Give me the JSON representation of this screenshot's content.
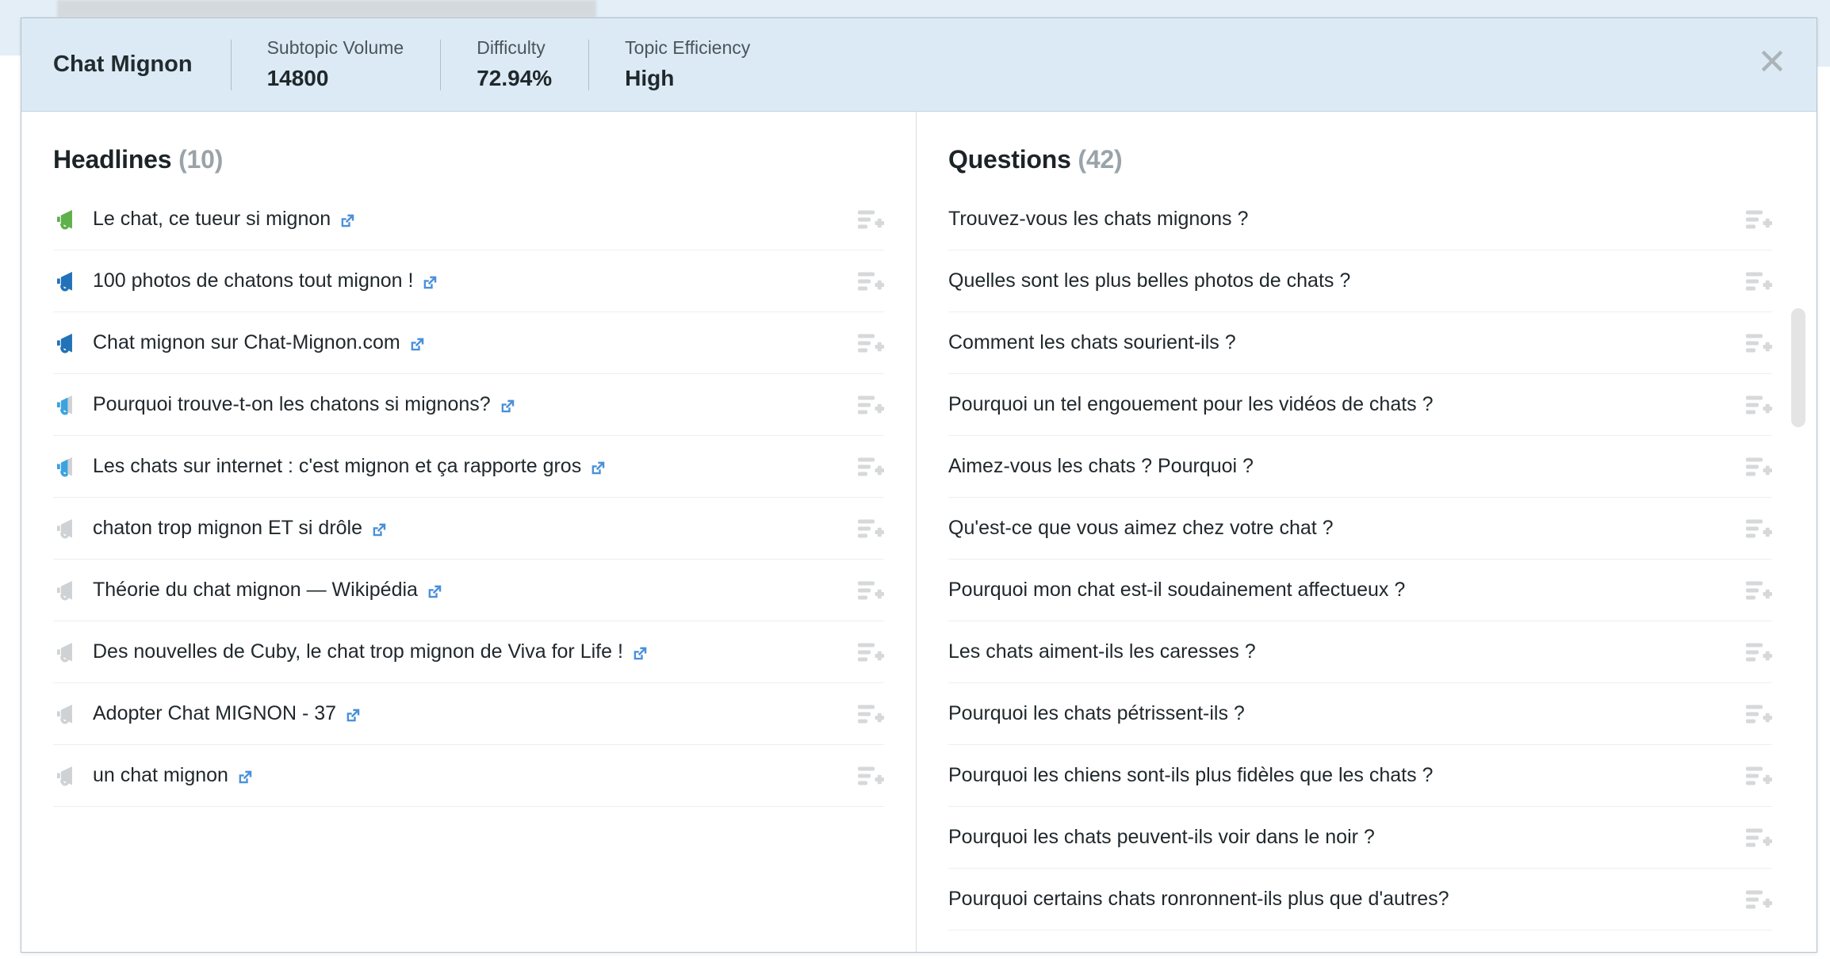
{
  "header": {
    "title": "Chat Mignon",
    "metrics": [
      {
        "label": "Subtopic Volume",
        "value": "14800"
      },
      {
        "label": "Difficulty",
        "value": "72.94%"
      },
      {
        "label": "Topic Efficiency",
        "value": "High"
      }
    ],
    "close_icon": "close-icon"
  },
  "colors": {
    "header_bg": "#dbeaf5",
    "megaphone_green": "#5eb14b",
    "megaphone_blue_dark": "#2272b9",
    "megaphone_blue_light": "#3ba3e0",
    "megaphone_grey": "#cfd2d4",
    "link_blue": "#4a90d9",
    "icon_grey": "#d6d8da"
  },
  "headlines": {
    "title": "Headlines",
    "count": "(10)",
    "items": [
      {
        "text": "Le chat, ce tueur si mignon",
        "icon": "megaphone-icon",
        "fill": 1.0,
        "color": "#5eb14b",
        "link_icon": "external-link-icon",
        "action_icon": "add-to-list-icon"
      },
      {
        "text": "100 photos de chatons tout mignon !",
        "icon": "megaphone-icon",
        "fill": 0.78,
        "color": "#2272b9",
        "link_icon": "external-link-icon",
        "action_icon": "add-to-list-icon"
      },
      {
        "text": "Chat mignon sur Chat-Mignon.com",
        "icon": "megaphone-icon",
        "fill": 0.78,
        "color": "#2272b9",
        "link_icon": "external-link-icon",
        "action_icon": "add-to-list-icon"
      },
      {
        "text": "Pourquoi trouve-t-on les chatons si mignons?",
        "icon": "megaphone-icon",
        "fill": 0.55,
        "color": "#3ba3e0",
        "link_icon": "external-link-icon",
        "action_icon": "add-to-list-icon"
      },
      {
        "text": "Les chats sur internet : c'est mignon et ça rapporte gros",
        "icon": "megaphone-icon",
        "fill": 0.55,
        "color": "#3ba3e0",
        "link_icon": "external-link-icon",
        "action_icon": "add-to-list-icon"
      },
      {
        "text": "chaton trop mignon ET si drôle",
        "icon": "megaphone-icon",
        "fill": 0.0,
        "color": "#cfd2d4",
        "link_icon": "external-link-icon",
        "action_icon": "add-to-list-icon"
      },
      {
        "text": "Théorie du chat mignon — Wikipédia",
        "icon": "megaphone-icon",
        "fill": 0.0,
        "color": "#cfd2d4",
        "link_icon": "external-link-icon",
        "action_icon": "add-to-list-icon"
      },
      {
        "text": "Des nouvelles de Cuby, le chat trop mignon de Viva for Life !",
        "icon": "megaphone-icon",
        "fill": 0.0,
        "color": "#cfd2d4",
        "link_icon": "external-link-icon",
        "action_icon": "add-to-list-icon"
      },
      {
        "text": "Adopter Chat MIGNON - 37",
        "icon": "megaphone-icon",
        "fill": 0.0,
        "color": "#cfd2d4",
        "link_icon": "external-link-icon",
        "action_icon": "add-to-list-icon"
      },
      {
        "text": "un chat mignon",
        "icon": "megaphone-icon",
        "fill": 0.0,
        "color": "#cfd2d4",
        "link_icon": "external-link-icon",
        "action_icon": "add-to-list-icon"
      }
    ]
  },
  "questions": {
    "title": "Questions",
    "count": "(42)",
    "items": [
      {
        "text": "Trouvez-vous les chats mignons ?",
        "action_icon": "add-to-list-icon"
      },
      {
        "text": "Quelles sont les plus belles photos de chats ?",
        "action_icon": "add-to-list-icon"
      },
      {
        "text": "Comment les chats sourient-ils ?",
        "action_icon": "add-to-list-icon"
      },
      {
        "text": "Pourquoi un tel engouement pour les vidéos de chats ?",
        "action_icon": "add-to-list-icon"
      },
      {
        "text": "Aimez-vous les chats ? Pourquoi ?",
        "action_icon": "add-to-list-icon"
      },
      {
        "text": "Qu'est-ce que vous aimez chez votre chat ?",
        "action_icon": "add-to-list-icon"
      },
      {
        "text": "Pourquoi mon chat est-il soudainement affectueux ?",
        "action_icon": "add-to-list-icon"
      },
      {
        "text": "Les chats aiment-ils les caresses ?",
        "action_icon": "add-to-list-icon"
      },
      {
        "text": "Pourquoi les chats pétrissent-ils ?",
        "action_icon": "add-to-list-icon"
      },
      {
        "text": "Pourquoi les chiens sont-ils plus fidèles que les chats ?",
        "action_icon": "add-to-list-icon"
      },
      {
        "text": "Pourquoi les chats peuvent-ils voir dans le noir ?",
        "action_icon": "add-to-list-icon"
      },
      {
        "text": "Pourquoi certains chats ronronnent-ils plus que d'autres?",
        "action_icon": "add-to-list-icon"
      }
    ]
  }
}
